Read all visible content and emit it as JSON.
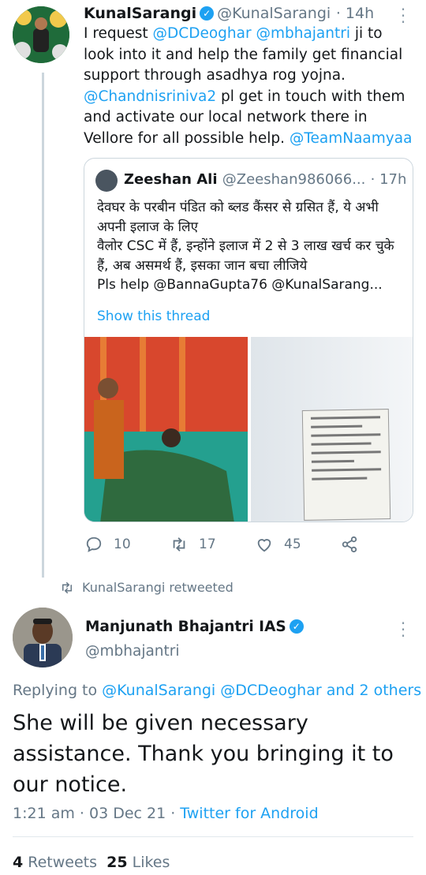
{
  "tweet1": {
    "author_name": "KunalSarangi",
    "author_handle": "@KunalSarangi",
    "time": "· 14h",
    "body_parts": {
      "t1": "I request ",
      "m1": "@DCDeoghar",
      "t2": " ",
      "m2": "@mbhajantri",
      "t3": " ji to look into it and help the  family get financial support through asadhya rog yojna. ",
      "m3": "@Chandnisriniva2",
      "t4": " pl get in touch with them and activate our local network there in Vellore for all possible help. ",
      "m4": "@TeamNaamyaa"
    }
  },
  "quote": {
    "author_name": "Zeeshan Ali",
    "author_handle": "@Zeeshan986066...",
    "time": "· 17h",
    "body": "देवघर के परबीन पंडित को ब्लड कैंसर से ग्रसित हैं, ये अभी अपनी इलाज के लिए\nवैलोर CSC में हैं, इन्होंने इलाज में 2 से 3 लाख खर्च कर चुके हैं, अब असमर्थ हैं, इसका जान बचा लीजिये\nPls help @BannaGupta76 @KunalSarang...",
    "show_thread": "Show this thread"
  },
  "actions": {
    "replies": "10",
    "retweets": "17",
    "likes": "45"
  },
  "retweeted_by": "KunalSarangi retweeted",
  "tweet2": {
    "author_name": "Manjunath Bhajantri IAS",
    "author_handle": "@mbhajantri",
    "replying_prefix": "Replying to ",
    "replying_to": "@KunalSarangi @DCDeoghar and 2 others",
    "body": "She will be given necessary assistance. Thank you bringing it to our notice.",
    "time": "1:21 am · 03 Dec 21 · ",
    "client": "Twitter for Android",
    "retweet_count": "4",
    "retweet_label": " Retweets  ",
    "like_count": "25",
    "like_label": " Likes"
  },
  "colors": {
    "accent": "#1da1f2",
    "secondary_text": "#657786",
    "border": "#ccd6dd"
  },
  "icons": [
    "verified-badge-icon",
    "more-options-icon",
    "reply-icon",
    "retweet-icon",
    "like-icon",
    "share-icon"
  ]
}
